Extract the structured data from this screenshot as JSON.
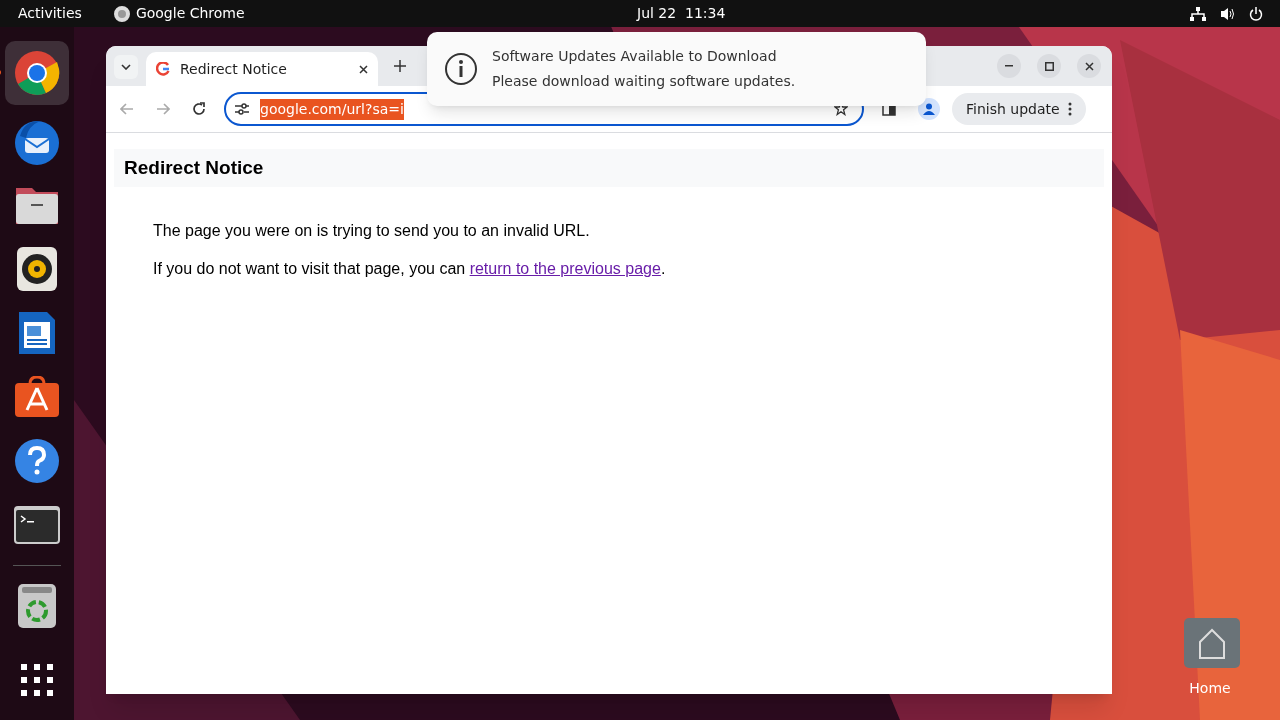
{
  "top_bar": {
    "activities": "Activities",
    "app_name": "Google Chrome",
    "clock": "Jul 22  11:34"
  },
  "dock": [
    {
      "kind": "chrome",
      "running": true
    },
    {
      "kind": "mail",
      "running": false
    },
    {
      "kind": "files",
      "running": false
    },
    {
      "kind": "music",
      "running": false
    },
    {
      "kind": "writer",
      "running": false
    },
    {
      "kind": "store",
      "running": false
    },
    {
      "kind": "help",
      "running": false
    },
    {
      "kind": "terminal",
      "running": false
    },
    {
      "kind": "separator"
    },
    {
      "kind": "trash",
      "running": false
    },
    {
      "kind": "apps",
      "running": false
    }
  ],
  "browser": {
    "tabs": [
      {
        "title": "Redirect Notice",
        "selected": true
      }
    ],
    "address": "google.com/url?sa=i",
    "address_selected": true,
    "update_button": "Finish update"
  },
  "page": {
    "heading": "Redirect Notice",
    "message": "The page you were on is trying to send you to an invalid URL.",
    "prompt": "If you do not want to visit that page, you can ",
    "link": "return to the previous page",
    "prompt_end": "."
  },
  "notification": {
    "title": "Software Updates Available to Download",
    "body": "Please download waiting software updates."
  },
  "desktop_icons": [
    {
      "label": "Home"
    }
  ]
}
